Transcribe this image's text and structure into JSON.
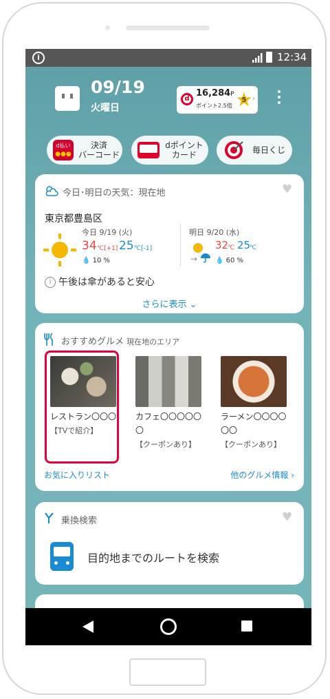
{
  "status": {
    "time": "12:34"
  },
  "header": {
    "date": "09/19",
    "weekday": "火曜日",
    "points": "16,284",
    "points_unit": "P",
    "points_sub": "ポイント2.5倍",
    "rank": "5"
  },
  "shortcuts": [
    {
      "label": "決済\nバーコード",
      "icon_text": "d払い"
    },
    {
      "label": "dポイント\nカード"
    },
    {
      "label": "毎日くじ"
    }
  ],
  "weather": {
    "title": "今日･明日の天気：現在地",
    "location": "東京都豊島区",
    "today": {
      "label": "今日 9/19 (火)",
      "high": "34",
      "high_diff": "℃[+1]",
      "low": "25",
      "low_diff": "℃[-1]",
      "rain": "10 %"
    },
    "tomorrow": {
      "label": "明日 9/20 (水)",
      "high": "32",
      "high_unit": "℃",
      "low": "25",
      "low_unit": "℃",
      "rain": "60 %"
    },
    "advice": "午後は傘があると安心",
    "more": "さらに表示"
  },
  "gourmet": {
    "title": "おすすめグルメ",
    "area": "現在地のエリア",
    "items": [
      {
        "name": "レストラン〇〇〇",
        "tag": "【TVで紹介】"
      },
      {
        "name": "カフェ〇〇〇〇〇〇",
        "tag": "【クーポンあり】"
      },
      {
        "name": "ラーメン〇〇〇〇〇〇",
        "tag": "【クーポンあり】"
      }
    ],
    "fav_link": "お気に入りリスト",
    "more_link": "他のグルメ情報"
  },
  "transit": {
    "title": "乗換検索",
    "action": "目的地までのルートを検索"
  },
  "colors": {
    "accent": "#1a8bd0",
    "highlight": "#e4003a",
    "docomo_red": "#e0002a"
  }
}
